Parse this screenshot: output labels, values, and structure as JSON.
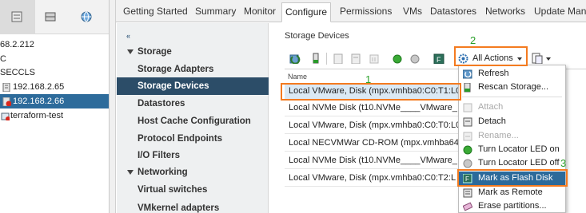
{
  "inventory": {
    "items": [
      {
        "label": "68.2.212"
      },
      {
        "label": "C"
      },
      {
        "label": "SECCLS"
      },
      {
        "label": "192.168.2.65"
      },
      {
        "label": "192.168.2.66"
      },
      {
        "label": "terraform-test"
      }
    ]
  },
  "tabs": [
    {
      "label": "Getting Started"
    },
    {
      "label": "Summary"
    },
    {
      "label": "Monitor"
    },
    {
      "label": "Configure"
    },
    {
      "label": "Permissions"
    },
    {
      "label": "VMs"
    },
    {
      "label": "Datastores"
    },
    {
      "label": "Networks"
    },
    {
      "label": "Update Mana"
    }
  ],
  "nav": {
    "collapse_glyph": "«",
    "items": [
      {
        "label": "Storage"
      },
      {
        "label": "Storage Adapters"
      },
      {
        "label": "Storage Devices"
      },
      {
        "label": "Datastores"
      },
      {
        "label": "Host Cache Configuration"
      },
      {
        "label": "Protocol Endpoints"
      },
      {
        "label": "I/O Filters"
      },
      {
        "label": "Networking"
      },
      {
        "label": "Virtual switches"
      },
      {
        "label": "VMkernel adapters"
      }
    ]
  },
  "content": {
    "title": "Storage Devices",
    "all_actions_label": "All Actions",
    "name_column": "Name",
    "rows": [
      {
        "name": "Local VMware, Disk (mpx.vmhba0:C0:T1:L0"
      },
      {
        "name": "Local NVMe Disk (t10.NVMe____VMware_"
      },
      {
        "name": "Local VMware, Disk (mpx.vmhba0:C0:T0:L0"
      },
      {
        "name": "Local NECVMWar CD-ROM (mpx.vmhba64"
      },
      {
        "name": "Local NVMe Disk (t10.NVMe____VMware_"
      },
      {
        "name": "Local VMware, Disk (mpx.vmhba0:C0:T2:L"
      }
    ]
  },
  "menu": {
    "items": [
      {
        "label": "Refresh"
      },
      {
        "label": "Rescan Storage..."
      },
      {
        "label": "Attach"
      },
      {
        "label": "Detach"
      },
      {
        "label": "Rename..."
      },
      {
        "label": "Turn Locator LED on"
      },
      {
        "label": "Turn Locator LED off"
      },
      {
        "label": "Mark as Flash Disk"
      },
      {
        "label": "Mark as Remote"
      },
      {
        "label": "Erase partitions..."
      }
    ]
  },
  "annotations": {
    "step1": "1",
    "step2": "2",
    "step3": "3"
  },
  "icons": {
    "toolbar": [
      "refresh-icon",
      "attach-icon",
      "detach-icon",
      "rename-icon",
      "led-on-icon",
      "led-off-icon",
      "flash-icon",
      "all-actions-gear-icon",
      "export-icon"
    ]
  },
  "colors": {
    "nav_active": "#2c4d68",
    "selection": "#2d6b9b",
    "highlight_box": "#f47b20",
    "annotation_text": "#2aa02a",
    "menu_highlight": "#2c6a9a"
  }
}
